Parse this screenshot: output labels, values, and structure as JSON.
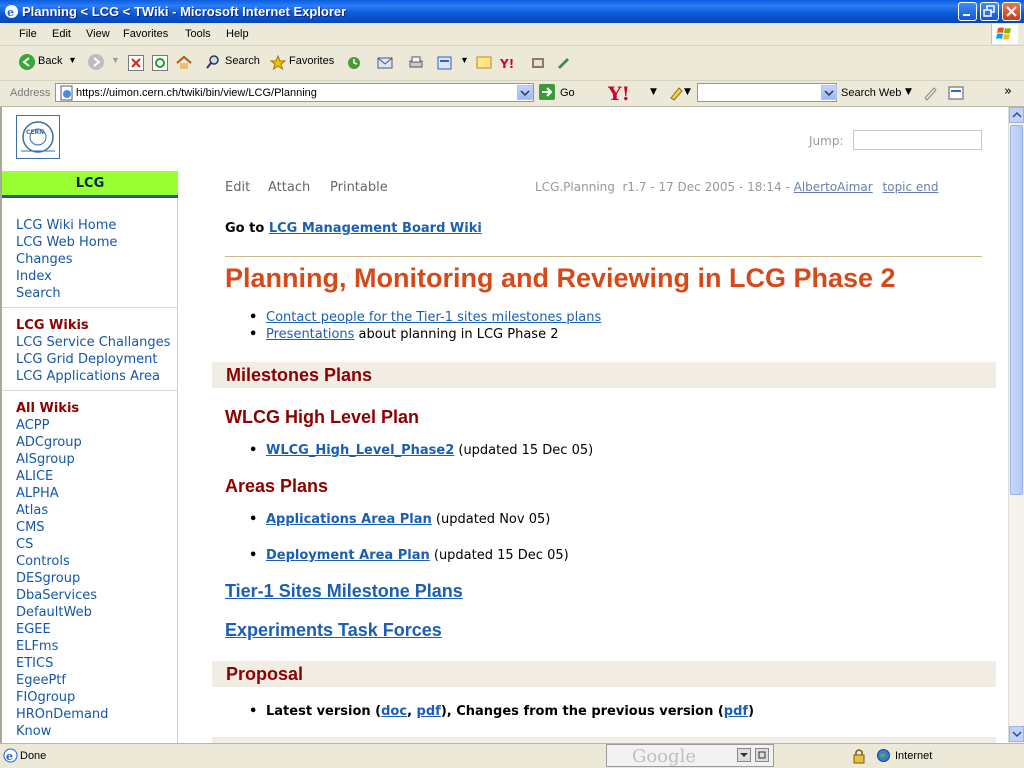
{
  "window": {
    "title": "Planning < LCG < TWiki - Microsoft Internet Explorer"
  },
  "menu": [
    "File",
    "Edit",
    "View",
    "Favorites",
    "Tools",
    "Help"
  ],
  "toolbar": {
    "back": "Back",
    "search": "Search",
    "favorites": "Favorites"
  },
  "address": {
    "label": "Address",
    "url": "https://uimon.cern.ch/twiki/bin/view/LCG/Planning",
    "go": "Go",
    "search_web": "Search Web"
  },
  "page": {
    "jump_label": "Jump:",
    "web_name": "LCG",
    "left_nav": {
      "group1": [
        "LCG Wiki Home",
        "LCG Web Home",
        "Changes",
        "Index",
        "Search"
      ],
      "group2_head": "LCG Wikis",
      "group2": [
        "LCG Service Challanges",
        "LCG Grid Deployment",
        "LCG Applications Area"
      ],
      "group3_head": "All Wikis",
      "group3": [
        "ACPP",
        "ADCgroup",
        "AISgroup",
        "ALICE",
        "ALPHA",
        "Atlas",
        "CMS",
        "CS",
        "Controls",
        "DESgroup",
        "DbaServices",
        "DefaultWeb",
        "EGEE",
        "ELFms",
        "ETICS",
        "EgeePtf",
        "FIOgroup",
        "HROnDemand",
        "Know"
      ]
    },
    "actions": {
      "edit": "Edit",
      "attach": "Attach",
      "printable": "Printable"
    },
    "topic_info": {
      "text": "LCG.Planning  r1.7 - 17 Dec 2005 - 18:14 - ",
      "author": "AlbertoAimar",
      "topic_end": "topic end"
    },
    "goto": {
      "prefix": "Go to ",
      "link": "LCG Management Board Wiki"
    },
    "heading": "Planning, Monitoring and Reviewing in LCG Phase 2",
    "intro": {
      "contact_link": "Contact people for the Tier-1 sites milestones plans",
      "presentations_link": "Presentations",
      "presentations_suffix": " about planning in LCG Phase 2"
    },
    "milestones": {
      "title": "Milestones Plans",
      "wlcg_title": "WLCG High Level Plan",
      "wlcg_link": "WLCG_High_Level_Phase2",
      "wlcg_suffix": " (updated 15 Dec 05)",
      "areas_title": "Areas Plans",
      "apps_link": "Applications Area Plan",
      "apps_suffix": " (updated Nov 05)",
      "deploy_link": "Deployment Area Plan",
      "deploy_suffix": " (updated 15 Dec 05)",
      "tier1_link": "Tier-1 Sites Milestone Plans",
      "exp_link": "Experiments Task Forces"
    },
    "proposal": {
      "title": "Proposal",
      "prefix": "Latest version (",
      "doc": "doc",
      "sep": ", ",
      "pdf": "pdf",
      "mid": "), Changes from the previous version (",
      "pdf2": "pdf",
      "end": ")"
    }
  },
  "status": {
    "done": "Done",
    "google": "Google",
    "zone": "Internet"
  }
}
